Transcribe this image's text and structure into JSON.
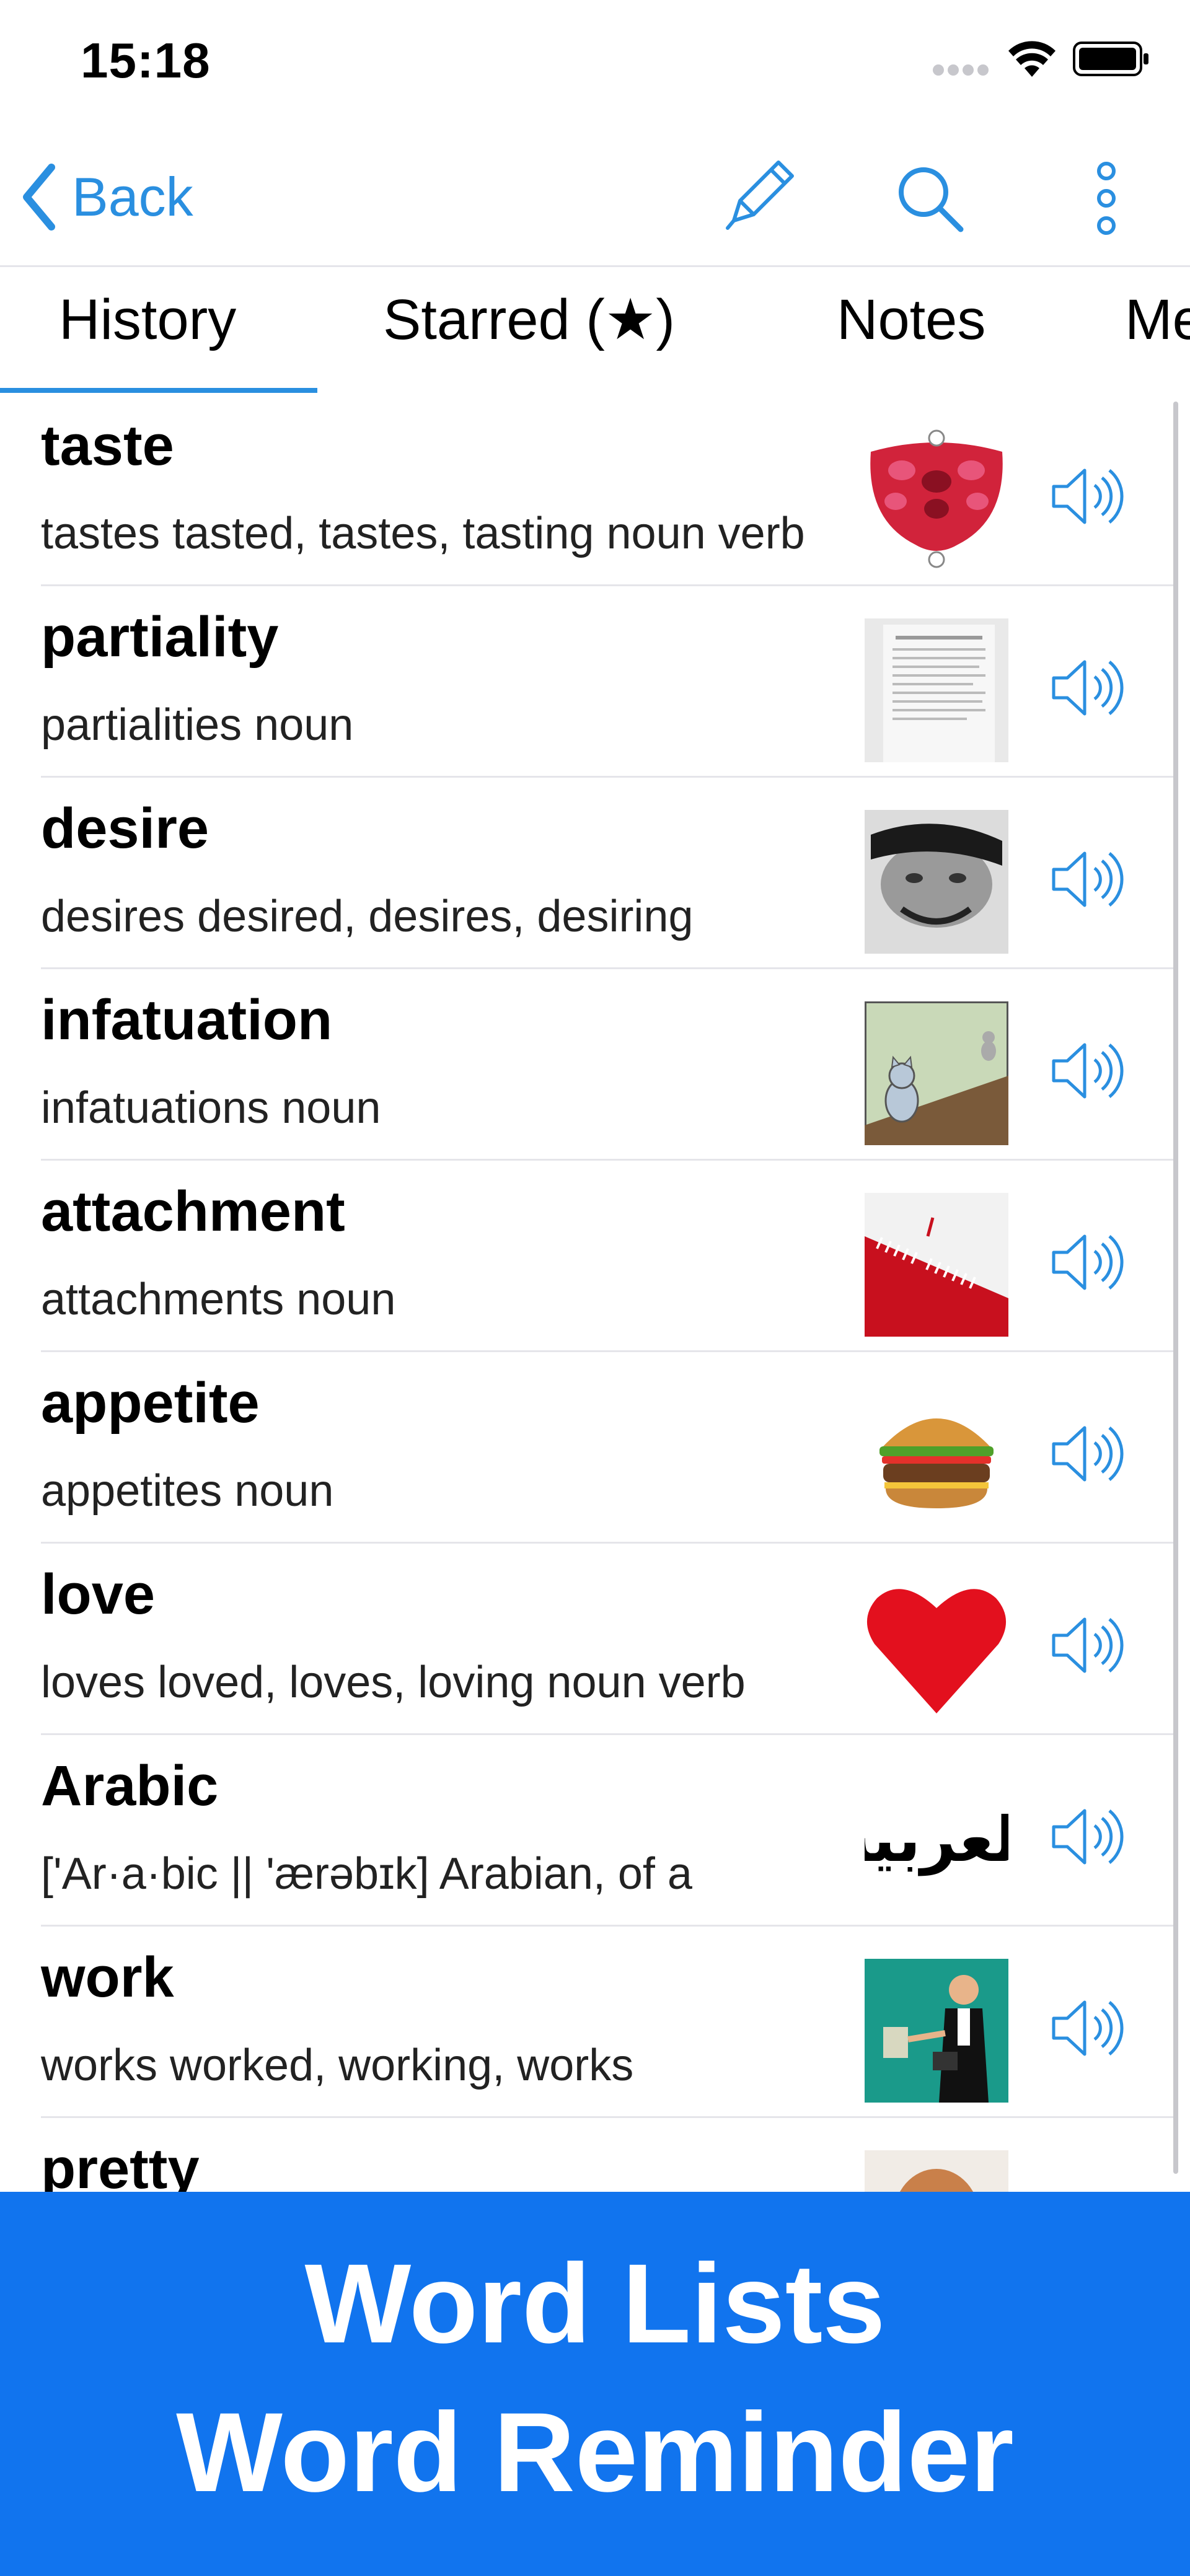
{
  "status_bar": {
    "time": "15:18"
  },
  "nav": {
    "back_label": "Back"
  },
  "tabs": [
    {
      "label": "History"
    },
    {
      "label": "Starred (★)"
    },
    {
      "label": "Notes"
    },
    {
      "label": "Me"
    }
  ],
  "accent_color": "#2a8fe0",
  "banner_color": "#1174ee",
  "words": [
    {
      "word": "taste",
      "forms": "tastes tasted, tastes, tasting noun verb",
      "image": "tongue-taste-zones-image"
    },
    {
      "word": "partiality",
      "forms": "partialities noun",
      "image": "document-page-image"
    },
    {
      "word": "desire",
      "forms": "desires desired, desires, desiring",
      "image": "face-photo-image"
    },
    {
      "word": "infatuation",
      "forms": "infatuations noun",
      "image": "cartoon-cat-image"
    },
    {
      "word": "attachment",
      "forms": "attachments noun",
      "image": "paper-clips-image"
    },
    {
      "word": "appetite",
      "forms": "appetites noun",
      "image": "burger-image"
    },
    {
      "word": "love",
      "forms": "loves loved, loves, loving noun verb",
      "image": "heart-image"
    },
    {
      "word": "Arabic",
      "forms": "['Ar·a·bic || 'ærəbɪk] Arabian, of a",
      "image": "arabic-script-image",
      "image_text": "العربية"
    },
    {
      "word": "work",
      "forms": "works worked, working, works",
      "image": "office-worker-image"
    },
    {
      "word": "pretty",
      "forms": "",
      "image": "portrait-photo-image"
    }
  ],
  "banner": {
    "line1": "Word Lists",
    "line2": "Word Reminder"
  }
}
